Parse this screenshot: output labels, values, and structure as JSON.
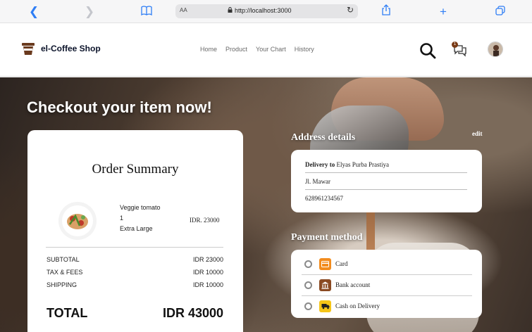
{
  "browser": {
    "text_size_label": "AA",
    "url": "http://localhost:3000"
  },
  "navbar": {
    "brand": "el-Coffee Shop",
    "menu": [
      "Home",
      "Product",
      "Your Chart",
      "History"
    ],
    "chat_badge_count": "1"
  },
  "hero": {
    "title": "Checkout your item now!"
  },
  "order_summary": {
    "title": "Order Summary",
    "item": {
      "name": "Veggie tomato",
      "quantity": "1",
      "size": "Extra Large",
      "price": "IDR. 23000"
    },
    "rows": [
      {
        "label": "SUBTOTAL",
        "value": "IDR 23000"
      },
      {
        "label": "TAX & FEES",
        "value": "IDR 10000"
      },
      {
        "label": "SHIPPING",
        "value": "IDR 10000"
      }
    ],
    "total_label": "TOTAL",
    "total_value": "IDR 43000"
  },
  "address": {
    "title": "Address details",
    "edit_label": "edit",
    "delivery_prefix": "Delivery to",
    "recipient": "Elyas Purba Prastiya",
    "street": "Jl. Mawar",
    "phone": "628961234567"
  },
  "payment": {
    "title": "Payment method",
    "options": [
      {
        "label": "Card",
        "icon": "card-icon",
        "color": "#f28c1e"
      },
      {
        "label": "Bank account",
        "icon": "bank-icon",
        "color": "#8a4a22"
      },
      {
        "label": "Cash on Delivery",
        "icon": "truck-icon",
        "color": "#f5c518"
      }
    ]
  }
}
